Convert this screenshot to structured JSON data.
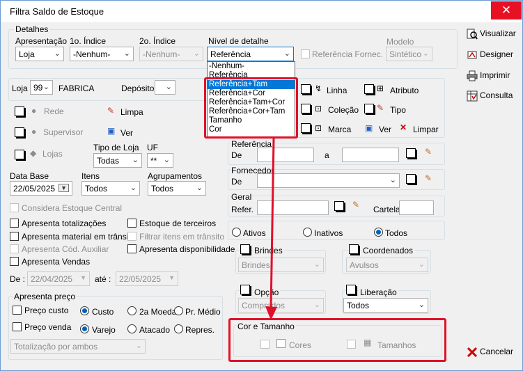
{
  "window": {
    "title": "Filtra Saldo de Estoque",
    "close": "✕"
  },
  "detalhes": {
    "legend": "Detalhes",
    "apresentacao_label": "Apresentação",
    "apresentacao_value": "Loja",
    "indice1_label": "1o. Índice",
    "indice1_value": "-Nenhum-",
    "indice2_label": "2o. Índice",
    "indice2_value": "-Nenhum-",
    "nivel_label": "Nível de detalhe",
    "nivel_value": "Referência",
    "ref_fornec": "Referência Fornec.",
    "modelo_label": "Modelo",
    "modelo_value": "Sintético"
  },
  "nivel_options": [
    "-Nenhum-",
    "Referência",
    "Referência+Tam",
    "Referência+Cor",
    "Referência+Tam+Cor",
    "Referência+Cor+Tam",
    "Tamanho",
    "Cor"
  ],
  "right_buttons": {
    "visualizar": "Visualizar",
    "designer": "Designer",
    "imprimir": "Imprimir",
    "consulta": "Consulta",
    "cancelar": "Cancelar"
  },
  "loja": {
    "label": "Loja",
    "value": "99",
    "name": "FABRICA",
    "deposito_label": "Depósito",
    "deposito_value": ""
  },
  "filters": {
    "rede": "Rede",
    "limpa": "Limpa",
    "supervisor": "Supervisor",
    "ver": "Ver",
    "lojas": "Lojas",
    "tipo_loja_label": "Tipo de Loja",
    "tipo_loja_value": "Todas",
    "uf_label": "UF",
    "uf_value": "**"
  },
  "date": {
    "base_label": "Data Base",
    "base_value": "22/05/2025",
    "itens_label": "Itens",
    "itens_value": "Todos",
    "agrup_label": "Agrupamentos",
    "agrup_value": "Todos"
  },
  "options": {
    "considera": "Considera Estoque Central",
    "totalizacoes": "Apresenta totalizações",
    "material": "Apresenta material em trânsito",
    "cod_aux": "Apresenta Cód. Auxiliar",
    "vendas": "Apresenta Vendas",
    "terceiros": "Estoque de terceiros",
    "filtrar": "Filtrar itens em trânsito",
    "disponib": "Apresenta disponibilidade"
  },
  "period": {
    "de_label": "De :",
    "de_value": "22/04/2025",
    "ate_label": "até :",
    "ate_value": "22/05/2025"
  },
  "preco": {
    "legend": "Apresenta preço",
    "custo_cb": "Preço custo",
    "venda_cb": "Preço venda",
    "custo": "Custo",
    "moeda2": "2a Moeda",
    "medio": "Pr. Médio",
    "varejo": "Varejo",
    "atacado": "Atacado",
    "repres": "Repres.",
    "totalizacao": "Totalização por ambos"
  },
  "product": {
    "linha": "Linha",
    "atributo": "Atributo",
    "colecao": "Coleção",
    "tipo": "Tipo",
    "marca": "Marca",
    "ver": "Ver",
    "limpar": "Limpar"
  },
  "referencia": {
    "legend": "Referência",
    "de": "De",
    "a": "a"
  },
  "fornecedor": {
    "legend": "Fornecedor",
    "de": "De"
  },
  "geral": {
    "legend": "Geral",
    "refer": "Refer.",
    "cartela": "Cartela"
  },
  "status": {
    "ativos": "Ativos",
    "inativos": "Inativos",
    "todos": "Todos"
  },
  "groups": {
    "brindes_title": "Brindes",
    "brindes_value": "Brindes",
    "coord_title": "Coordenados",
    "coord_value": "Avulsos",
    "opcao_title": "Opção",
    "opcao_value": "Comprados",
    "lib_title": "Liberação",
    "lib_value": "Todos"
  },
  "cor_tamanho": {
    "legend": "Cor e Tamanho",
    "cores": "Cores",
    "tamanhos": "Tamanhos"
  }
}
